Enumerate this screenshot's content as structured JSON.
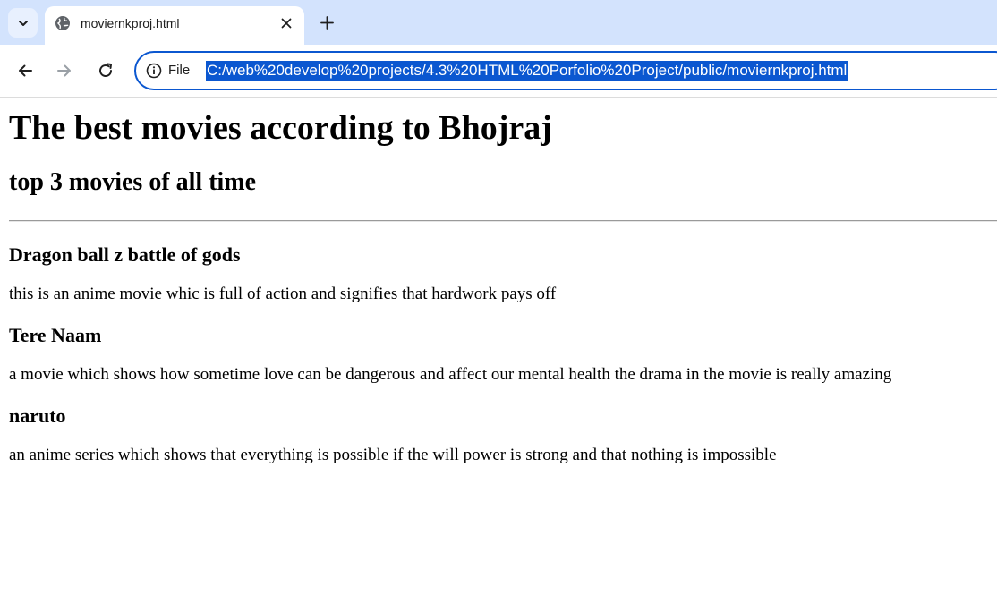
{
  "browser": {
    "tab": {
      "title": "moviernkproj.html"
    },
    "address_bar": {
      "security_label": "File",
      "url": "C:/web%20develop%20projects/4.3%20HTML%20Porfolio%20Project/public/moviernkproj.html"
    },
    "icons": {
      "tab_search": "chevron-down-icon",
      "favicon": "globe-icon",
      "close": "close-icon",
      "new_tab": "plus-icon",
      "back": "back-arrow-icon",
      "forward": "forward-arrow-icon",
      "reload": "reload-icon",
      "info": "info-icon"
    },
    "colors": {
      "tabstrip": "#d3e3fd",
      "omnibox_border": "#0b57d0",
      "selection": "#0b57d0"
    }
  },
  "page": {
    "heading": "The best movies according to Bhojraj",
    "subheading": "top 3 movies of all time",
    "movies": [
      {
        "title": "Dragon ball z battle of gods",
        "description": "this is an anime movie whic is full of action and signifies that hardwork pays off"
      },
      {
        "title": "Tere Naam",
        "description": "a movie which shows how sometime love can be dangerous and affect our mental health the drama in the movie is really amazing"
      },
      {
        "title": "naruto",
        "description": "an anime series which shows that everything is possible if the will power is strong and that nothing is impossible"
      }
    ]
  }
}
